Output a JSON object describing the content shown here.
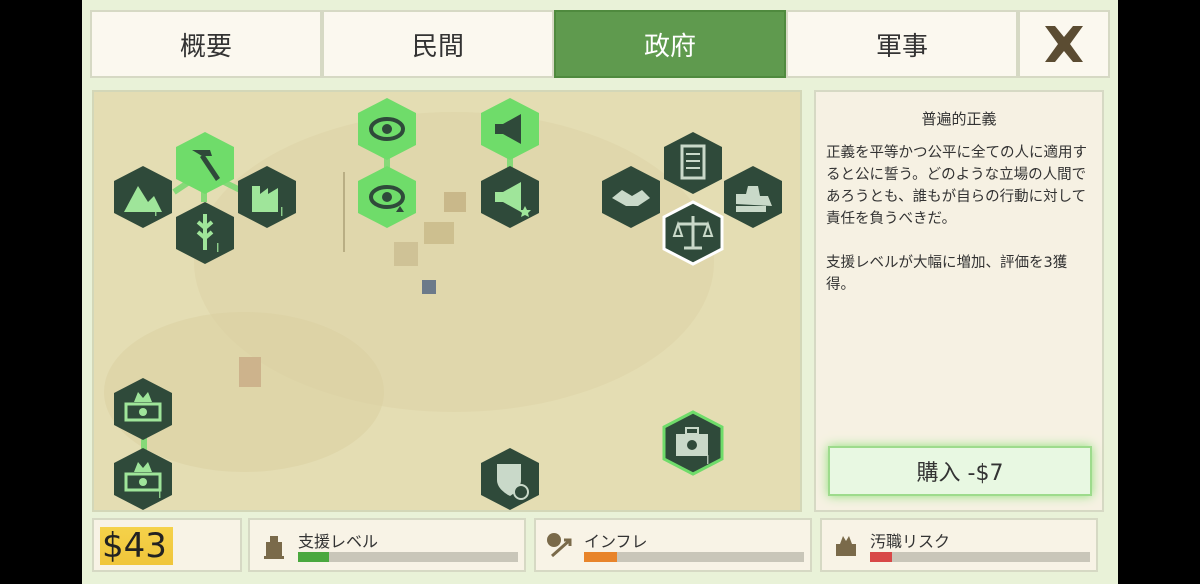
{
  "tabs": [
    {
      "label": "概要",
      "active": false
    },
    {
      "label": "民間",
      "active": false
    },
    {
      "label": "政府",
      "active": true
    },
    {
      "label": "軍事",
      "active": false
    }
  ],
  "info": {
    "title": "普遍的正義",
    "description": "正義を平等かつ公平に全ての人に適用すると公に誓う。どのような立場の人間であろうとも、誰もが自らの行動に対して責任を負うべきだ。\n\n支援レベルが大幅に増加、評価を3獲得。",
    "buy_label": "購入 -$7"
  },
  "money": "$43",
  "meters": [
    {
      "label": "支援レベル",
      "icon": "monument-icon",
      "level": 0.14,
      "color": "#4aa83e"
    },
    {
      "label": "インフレ",
      "icon": "inflation-icon",
      "level": 0.15,
      "color": "#e8842a"
    },
    {
      "label": "汚職リスク",
      "icon": "corruption-icon",
      "level": 0.1,
      "color": "#d84848"
    }
  ],
  "nodes": [
    {
      "id": "hammer",
      "icon": "hammer-icon",
      "state": "available"
    },
    {
      "id": "mountain-pick",
      "icon": "mountain-pick-icon",
      "state": "locked"
    },
    {
      "id": "wheat",
      "icon": "wheat-icon",
      "state": "locked"
    },
    {
      "id": "factory",
      "icon": "factory-icon",
      "state": "locked"
    },
    {
      "id": "eye",
      "icon": "eye-icon",
      "state": "available"
    },
    {
      "id": "eye-up",
      "icon": "eye-up-icon",
      "state": "available"
    },
    {
      "id": "megaphone",
      "icon": "megaphone-icon",
      "state": "available"
    },
    {
      "id": "megaphone-star",
      "icon": "megaphone-star-icon",
      "state": "locked"
    },
    {
      "id": "checklist",
      "icon": "checklist-icon",
      "state": "locked"
    },
    {
      "id": "handshake",
      "icon": "handshake-icon",
      "state": "locked"
    },
    {
      "id": "bulldozer",
      "icon": "bulldozer-icon",
      "state": "locked"
    },
    {
      "id": "scales",
      "icon": "scales-icon",
      "state": "selected"
    },
    {
      "id": "money-burn",
      "icon": "money-burn-icon",
      "state": "locked"
    },
    {
      "id": "money-burn-2",
      "icon": "money-burn-2-icon",
      "state": "locked"
    },
    {
      "id": "shield-money",
      "icon": "shield-money-icon",
      "state": "locked"
    },
    {
      "id": "briefcase",
      "icon": "briefcase-icon",
      "state": "available"
    }
  ],
  "colors": {
    "active_tab": "#5f9a4e",
    "available_node": "#6fdc6a",
    "locked_node": "#2f4a3a",
    "frame": "#e9f2d8"
  }
}
